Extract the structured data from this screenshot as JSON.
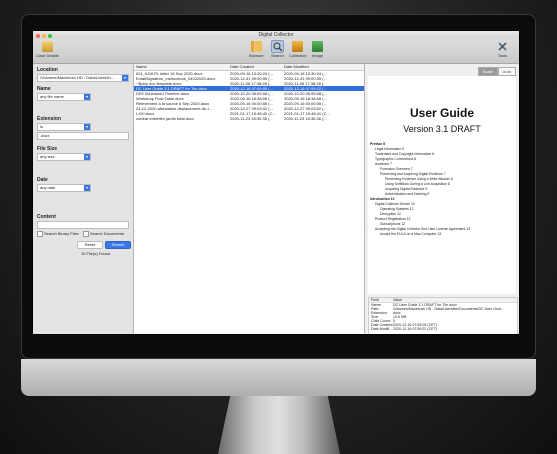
{
  "window": {
    "title": "Digital Collector"
  },
  "toolbar": {
    "case_details": "Case Details",
    "browser": "Browser",
    "search": "Search",
    "collection": "Collection",
    "image": "Image",
    "tools": "Tools"
  },
  "search_panel": {
    "location_label": "Location",
    "location_value": "/Volumes/Macintosh HD - Data/Users/th...",
    "name_label": "Name",
    "name_select": "any file name",
    "extension_label": "Extension",
    "extension_select": "is",
    "extension_value": ".docx",
    "file_size_label": "File Size",
    "file_size_select": "any size",
    "date_label": "Date",
    "date_select": "any date",
    "content_label": "Content",
    "content_value": "",
    "search_binary": "Search Binary Files",
    "search_documents": "Search Documents",
    "reset": "Reset",
    "search": "Search",
    "found": "10 File(s) Found"
  },
  "results": {
    "columns": [
      "Name",
      "Date Created",
      "Date Modified"
    ],
    "rows": [
      [
        "001_AGA PL letter 16 Sep 2020.docx",
        "2020-09-18 13:30:24 (...",
        "2020-09-18 13:30:24 (..."
      ],
      [
        "EmailSignature_Instructions_04022020.docx",
        "2020-12-31 09:00:05 (...",
        "2020-12-31 09:00:05 (..."
      ],
      [
        "~$ploy doc template.docx",
        "2020-11-08 17:38:28 (...",
        "2020-11-08 17:38:28 (..."
      ],
      [
        "DC User Guide 3.1 DRAFT for Tim.docx",
        "2020-12-16 07:59:05 (...",
        "2020-12-16 07:59:22 (..."
      ],
      [
        "DF8 Scheduled Timeline.docx",
        "2020-10-20 06:59:08 (...",
        "2020-10-20 06:59:08 (..."
      ],
      [
        "Workshop Flow Table.docx",
        "2020-09-16 18:38:08 (...",
        "2020-09-16 18:38:08 (..."
      ],
      [
        "Relevement a la source 6 Sep 2020.docx",
        "2020-09-16 00:00:05 (...",
        "2020-09-16 00:00:05 (..."
      ],
      [
        "24-12-2020-attestation-deplacement-du-t...",
        "2020-12-27 09:03:02 (...",
        "2020-12-27 09:03:02 (..."
      ],
      [
        "LXXI.docx",
        "2021-01-17 15:48:40 (C...",
        "2021-01-17 15:48:41 (C..."
      ],
      [
        "contrat entretien jardin total.docx",
        "2020-11-23 18:30:38 (...",
        "2020-11-23 18:30:38 (..."
      ]
    ],
    "selected_index": 3
  },
  "preview": {
    "tabs": [
      "Scale",
      "Auto"
    ],
    "doc_title": "User Guide",
    "doc_version": "Version 3.1 DRAFT",
    "toc": [
      {
        "text": "Preface    8",
        "level": 0
      },
      {
        "text": "Legal Information    5",
        "level": 1
      },
      {
        "text": "Trademark and Copyright Information    6",
        "level": 1
      },
      {
        "text": "Typographic Conventions    6",
        "level": 1
      },
      {
        "text": "Audience    7",
        "level": 1
      },
      {
        "text": "Forensics Overview    7",
        "level": 2
      },
      {
        "text": "Preserving and Acquiring Digital Evidence    7",
        "level": 2
      },
      {
        "text": "Preserving Evidence Using a Write-Blocker    8",
        "level": 3
      },
      {
        "text": "Using SoftBlock During a Live Acquisition    8",
        "level": 3
      },
      {
        "text": "Acquiring Digital Evidence    9",
        "level": 3
      },
      {
        "text": "Authentication and Hashing    9",
        "level": 3
      },
      {
        "text": "Introduction    10",
        "level": 0
      },
      {
        "text": "Digital Collector Device    10",
        "level": 1
      },
      {
        "text": "Operating Systems    12",
        "level": 2
      },
      {
        "text": "Decryption    12",
        "level": 2
      },
      {
        "text": "Product Registration    12",
        "level": 1
      },
      {
        "text": "Subscriptions    12",
        "level": 2
      },
      {
        "text": "Accepting the Digital Collector End User License Agreement    13",
        "level": 1
      },
      {
        "text": "Accept the EULA on a Mac Computer    13",
        "level": 2
      }
    ]
  },
  "metadata": {
    "headers": [
      "Field",
      "Value"
    ],
    "rows": [
      [
        "Name:",
        "DC User Guide 3.1 DRAFT for Tim.docx"
      ],
      [
        "Path:",
        "/Volumes/Macintosh HD - Data/Users/tim/Documents/DC User Guid..."
      ],
      [
        "Extension:",
        "docx"
      ],
      [
        "Size:",
        "19.6 MB"
      ],
      [
        "Child Count:",
        "0"
      ],
      [
        "Date Created:",
        "2020-12-16 07:59:05 (CET)"
      ],
      [
        "Date Modifi...",
        "2020-12-16 07:59:22 (CET)"
      ]
    ]
  },
  "colors": {
    "accent": "#2f6fdb",
    "select_arrow": "#3b78e7"
  }
}
